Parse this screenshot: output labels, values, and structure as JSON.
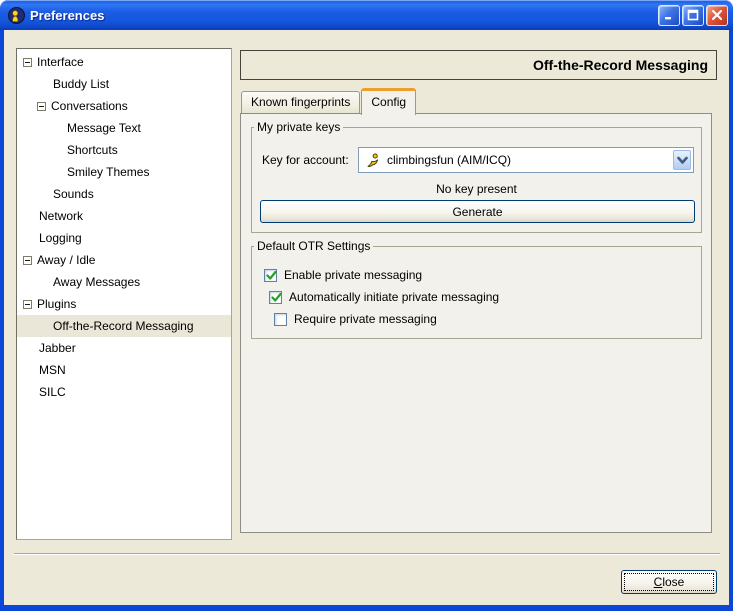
{
  "window": {
    "title": "Preferences",
    "controls": {
      "minimize": "Minimize",
      "maximize": "Maximize",
      "close": "Close"
    }
  },
  "tree": {
    "items": [
      {
        "label": "Interface",
        "level": 0,
        "expander": true,
        "selected": false
      },
      {
        "label": "Buddy List",
        "level": 1,
        "expander": false,
        "selected": false
      },
      {
        "label": "Conversations",
        "level": 1,
        "expander": true,
        "selected": false
      },
      {
        "label": "Message Text",
        "level": 2,
        "expander": false,
        "selected": false
      },
      {
        "label": "Shortcuts",
        "level": 2,
        "expander": false,
        "selected": false
      },
      {
        "label": "Smiley Themes",
        "level": 2,
        "expander": false,
        "selected": false
      },
      {
        "label": "Sounds",
        "level": 1,
        "expander": false,
        "selected": false
      },
      {
        "label": "Network",
        "level": 0,
        "expander": false,
        "selected": false
      },
      {
        "label": "Logging",
        "level": 0,
        "expander": false,
        "selected": false
      },
      {
        "label": "Away / Idle",
        "level": 0,
        "expander": true,
        "selected": false
      },
      {
        "label": "Away Messages",
        "level": 1,
        "expander": false,
        "selected": false
      },
      {
        "label": "Plugins",
        "level": 0,
        "expander": true,
        "selected": false
      },
      {
        "label": "Off-the-Record Messaging",
        "level": 1,
        "expander": false,
        "selected": true
      },
      {
        "label": "Jabber",
        "level": 0,
        "expander": false,
        "selected": false
      },
      {
        "label": "MSN",
        "level": 0,
        "expander": false,
        "selected": false
      },
      {
        "label": "SILC",
        "level": 0,
        "expander": false,
        "selected": false
      }
    ]
  },
  "panel": {
    "heading": "Off-the-Record Messaging",
    "tabs": [
      {
        "label": "Known fingerprints",
        "active": false
      },
      {
        "label": "Config",
        "active": true
      }
    ],
    "private_keys": {
      "legend": "My private keys",
      "account_label": "Key for account:",
      "account_value": "climbingsfun (AIM/ICQ)",
      "account_icon": "aim-running-man-icon",
      "key_status": "No key present",
      "generate_label": "Generate"
    },
    "otr_settings": {
      "legend": "Default OTR Settings",
      "checkboxes": [
        {
          "label": "Enable private messaging",
          "checked": true,
          "indent": 0
        },
        {
          "label": "Automatically initiate private messaging",
          "checked": true,
          "indent": 1
        },
        {
          "label": "Require private messaging",
          "checked": false,
          "indent": 2
        }
      ]
    }
  },
  "footer": {
    "close_label": "Close"
  },
  "colors": {
    "titlebar_blue": "#1C5CE4",
    "frame_blue": "#0A47D8",
    "content_beige": "#ECE9D8",
    "panel_bg": "#F2F1EB",
    "tree_selection": "#EAE6D8",
    "active_tab_accent": "#EE9D2F",
    "check_green": "#23A123",
    "combo_border": "#7F9DB9",
    "button_border": "#003C74",
    "separator": "#ACA899"
  }
}
